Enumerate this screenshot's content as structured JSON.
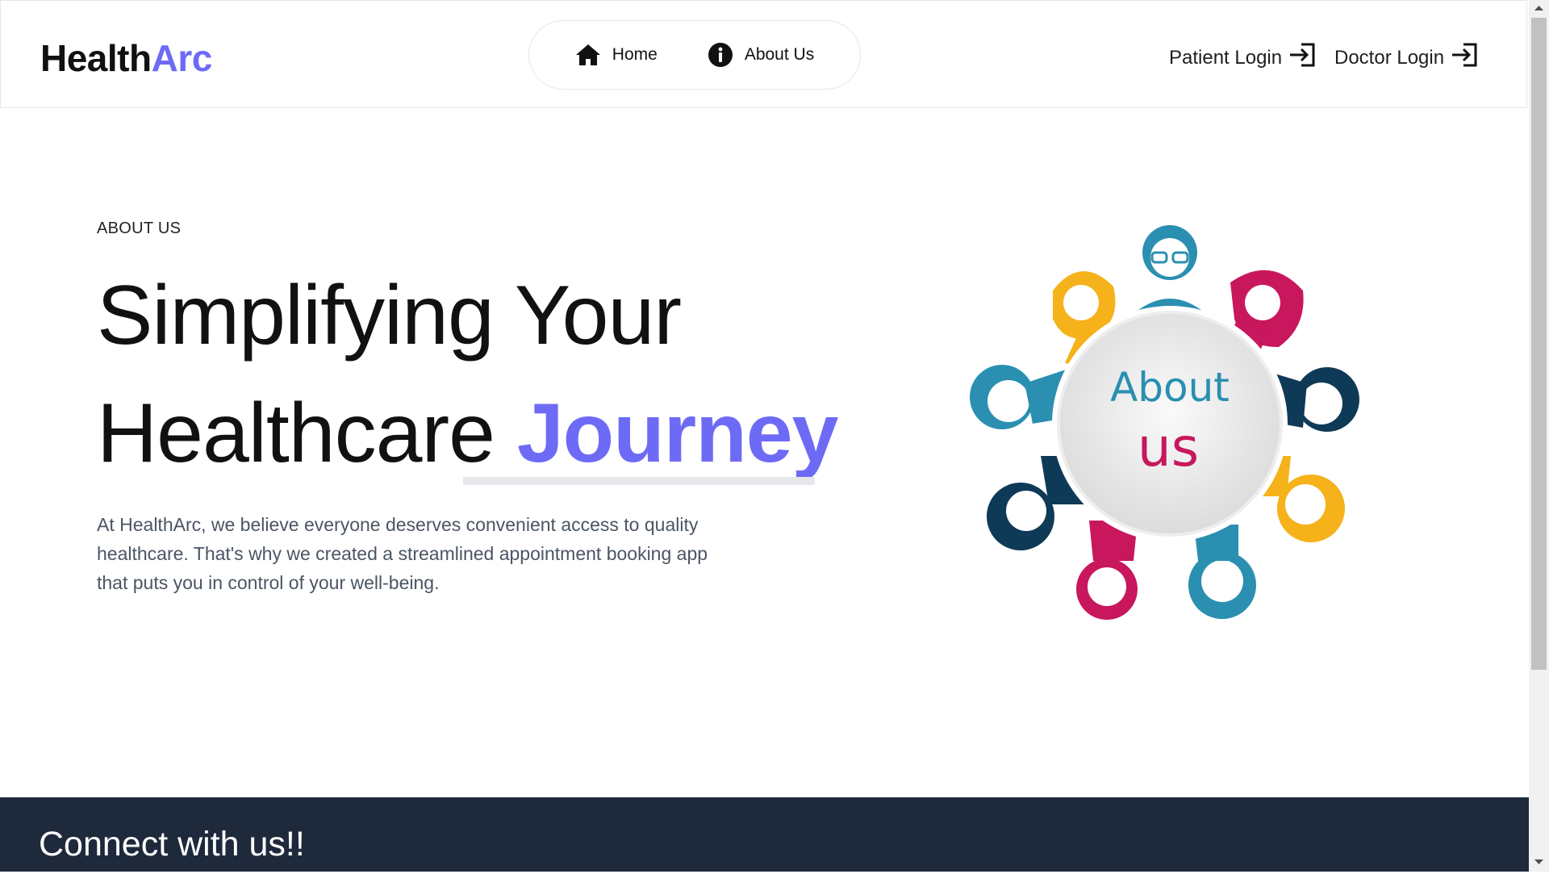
{
  "header": {
    "logo_part1": "Health",
    "logo_part2": "Arc",
    "nav": [
      {
        "label": "Home",
        "icon": "home-icon"
      },
      {
        "label": "About Us",
        "icon": "info-icon"
      }
    ],
    "patient_login": "Patient Login",
    "doctor_login": "Doctor Login",
    "login_icon": "login-arrow-icon"
  },
  "hero": {
    "eyebrow": "ABOUT US",
    "headline_line1": "Simplifying Your",
    "headline_line2_prefix": "Healthcare ",
    "headline_accent": "Journey",
    "paragraph": "At HealthArc, we believe everyone deserves convenient access to quality healthcare. That's why we created a streamlined appointment booking app that puts you in control of your well-being.",
    "illustration": {
      "title_line1": "About",
      "title_line2": "us"
    }
  },
  "footer": {
    "title": "Connect with us!!"
  },
  "colors": {
    "accent": "#6d6bf5",
    "footer_bg": "#1e293b",
    "illus_teal": "#2a8fb0",
    "illus_navy": "#0f3a57",
    "illus_yellow": "#f6b21b",
    "illus_magenta": "#c8175d"
  }
}
